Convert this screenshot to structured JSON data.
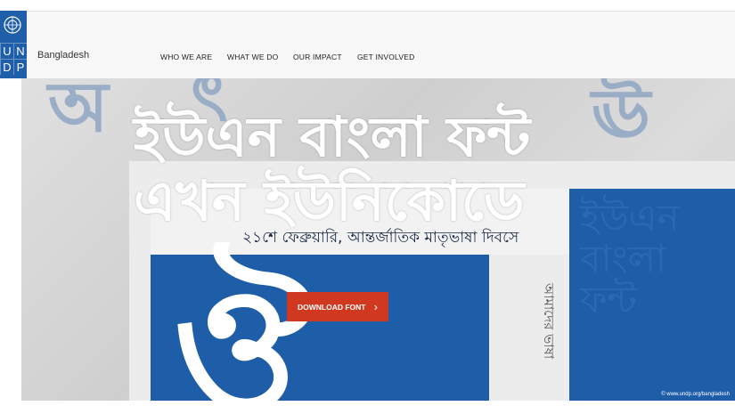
{
  "logo": {
    "letters": [
      "U",
      "N",
      "D",
      "P"
    ]
  },
  "header": {
    "country": "Bangladesh"
  },
  "nav": {
    "items": [
      {
        "label": "WHO WE ARE"
      },
      {
        "label": "WHAT WE DO"
      },
      {
        "label": "OUR IMPACT"
      },
      {
        "label": "GET INVOLVED"
      }
    ]
  },
  "hero": {
    "title_line1": "ইউএন বাংলা ফন্ট",
    "title_line2": "এখন ইউনিকোডে",
    "subtitle": "২১শে ফেব্রুয়ারি, আন্তর্জাতিক মাতৃভাষা দিবসে",
    "download_label": "DOWNLOAD FONT",
    "credit": "© www.undp.org/bangladesh",
    "accent_color": "#d0391f",
    "brand_color": "#1e5ea8"
  }
}
